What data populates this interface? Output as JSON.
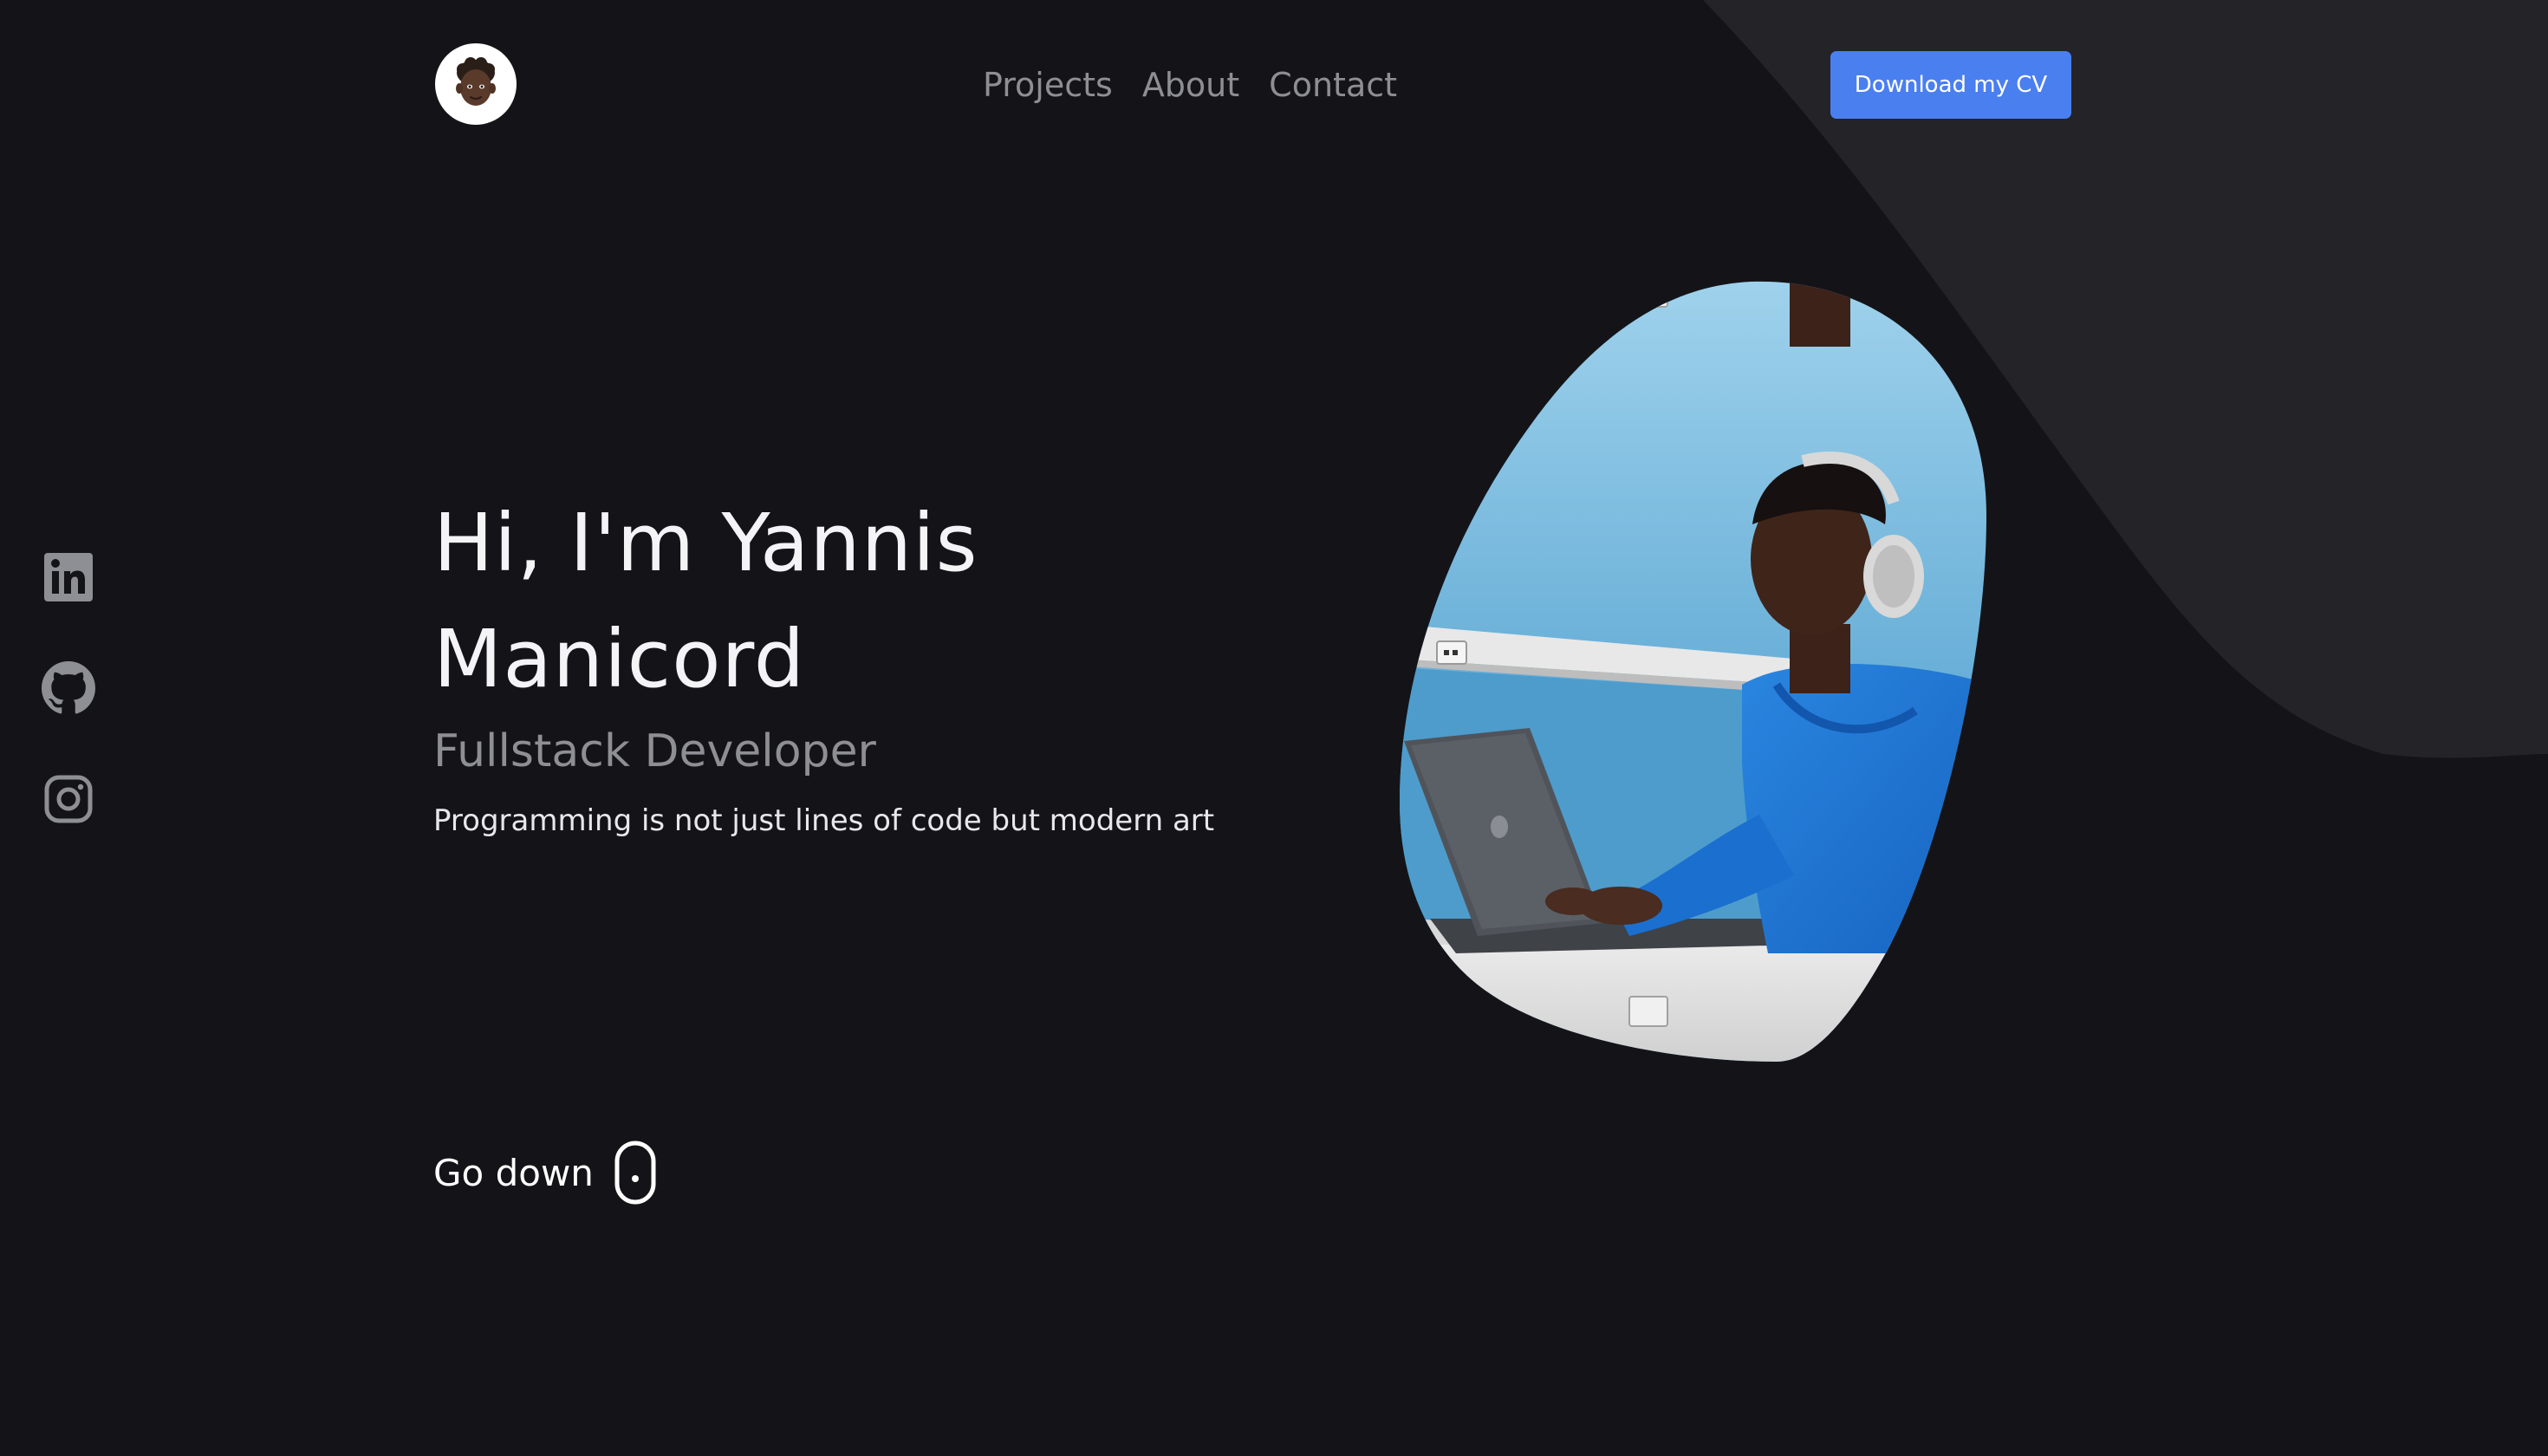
{
  "header": {
    "logo_icon": "memoji-avatar-icon",
    "nav": [
      {
        "label": "Projects"
      },
      {
        "label": "About"
      },
      {
        "label": "Contact"
      }
    ],
    "cv_button_label": "Download my CV"
  },
  "social": [
    {
      "icon": "linkedin-icon"
    },
    {
      "icon": "github-icon"
    },
    {
      "icon": "instagram-icon"
    }
  ],
  "hero": {
    "title_line1": "Hi, I'm Yannis",
    "title_line2": "Manicord",
    "role": "Fullstack Developer",
    "tagline": "Programming is not just lines of code but modern art"
  },
  "go_down": {
    "label": "Go down",
    "icon": "mouse-icon"
  },
  "theme": {
    "background": "#141418",
    "shape": "#232328",
    "accent": "#4a7ff0",
    "muted_text": "#8e8e95"
  }
}
